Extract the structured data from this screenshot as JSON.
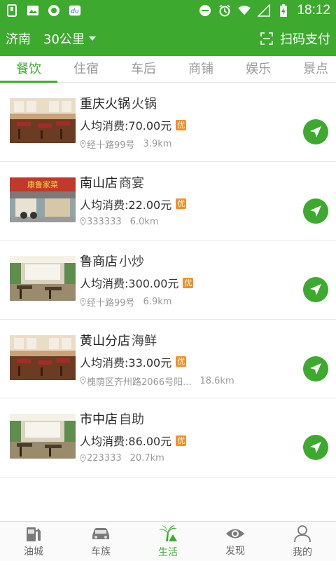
{
  "status_bar": {
    "time": "18:12",
    "left_icons": [
      "sim-icon",
      "image-icon",
      "sync-icon",
      "du-app-icon"
    ],
    "right_icons": [
      "dnd-icon",
      "alarm-icon",
      "wifi-icon",
      "signal-icon",
      "battery-icon"
    ]
  },
  "header": {
    "city": "济南",
    "distance": "30公里",
    "scan_label": "扫码支付"
  },
  "tabs": [
    {
      "label": "餐饮",
      "active": true
    },
    {
      "label": "住宿",
      "active": false
    },
    {
      "label": "车后",
      "active": false
    },
    {
      "label": "商铺",
      "active": false
    },
    {
      "label": "娱乐",
      "active": false
    },
    {
      "label": "景点",
      "active": false
    }
  ],
  "listings": [
    {
      "name": "重庆火锅",
      "category": "火锅",
      "price": "人均消费:70.00元",
      "badge": "优",
      "address": "经十路99号",
      "distance": "3.9km"
    },
    {
      "name": "南山店",
      "category": "商宴",
      "price": "人均消费:22.00元",
      "badge": "优",
      "address": "333333",
      "distance": "6.0km"
    },
    {
      "name": "鲁商店",
      "category": "小炒",
      "price": "人均消费:300.00元",
      "badge": "优",
      "address": "经十路99号",
      "distance": "6.9km"
    },
    {
      "name": "黄山分店",
      "category": "海鲜",
      "price": "人均消费:33.00元",
      "badge": "优",
      "address": "槐荫区齐州路2066号阳...",
      "distance": "18.6km"
    },
    {
      "name": "市中店",
      "category": "自助",
      "price": "人均消费:86.00元",
      "badge": "优",
      "address": "223333",
      "distance": "20.7km"
    }
  ],
  "thumb_sign_text": "康鲁家菜",
  "bottom_nav": [
    {
      "label": "油城",
      "icon": "fuel-pump-icon",
      "active": false
    },
    {
      "label": "车族",
      "icon": "car-icon",
      "active": false
    },
    {
      "label": "生活",
      "icon": "palm-tree-icon",
      "active": true
    },
    {
      "label": "发现",
      "icon": "eye-icon",
      "active": false
    },
    {
      "label": "我的",
      "icon": "person-icon",
      "active": false
    }
  ],
  "colors": {
    "brand_green": "#3daa2f",
    "badge_orange": "#f0902a"
  }
}
